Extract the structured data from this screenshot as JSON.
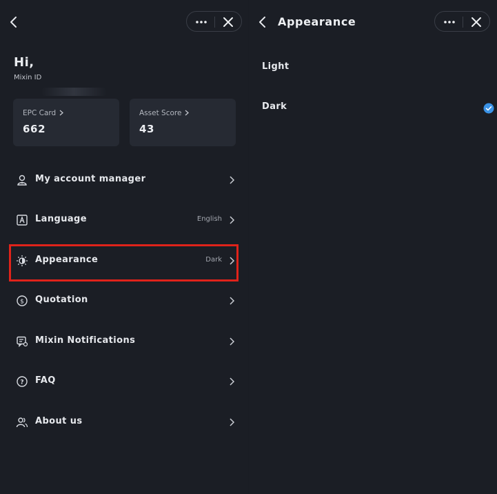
{
  "left_panel": {
    "greeting": "Hi,",
    "mixin_id_label": "Mixin ID",
    "cards": [
      {
        "label": "EPC Card",
        "value": "662"
      },
      {
        "label": "Asset Score",
        "value": "43"
      }
    ],
    "menu": [
      {
        "label": "My account manager",
        "value": "",
        "icon": "user-icon"
      },
      {
        "label": "Language",
        "value": "English",
        "icon": "language-icon"
      },
      {
        "label": "Appearance",
        "value": "Dark",
        "icon": "sun-moon-icon"
      },
      {
        "label": "Quotation",
        "value": "",
        "icon": "dollar-icon"
      },
      {
        "label": "Mixin Notifications",
        "value": "",
        "icon": "notification-icon"
      },
      {
        "label": "FAQ",
        "value": "",
        "icon": "question-icon"
      },
      {
        "label": "About us",
        "value": "",
        "icon": "people-icon"
      }
    ],
    "highlighted_item": "Appearance"
  },
  "right_panel": {
    "title": "Appearance",
    "options": [
      {
        "label": "Light",
        "selected": false
      },
      {
        "label": "Dark",
        "selected": true
      }
    ]
  },
  "colors": {
    "background": "#1b1e25",
    "card": "#262a33",
    "highlight": "#e0231a",
    "check": "#3a92e6"
  }
}
